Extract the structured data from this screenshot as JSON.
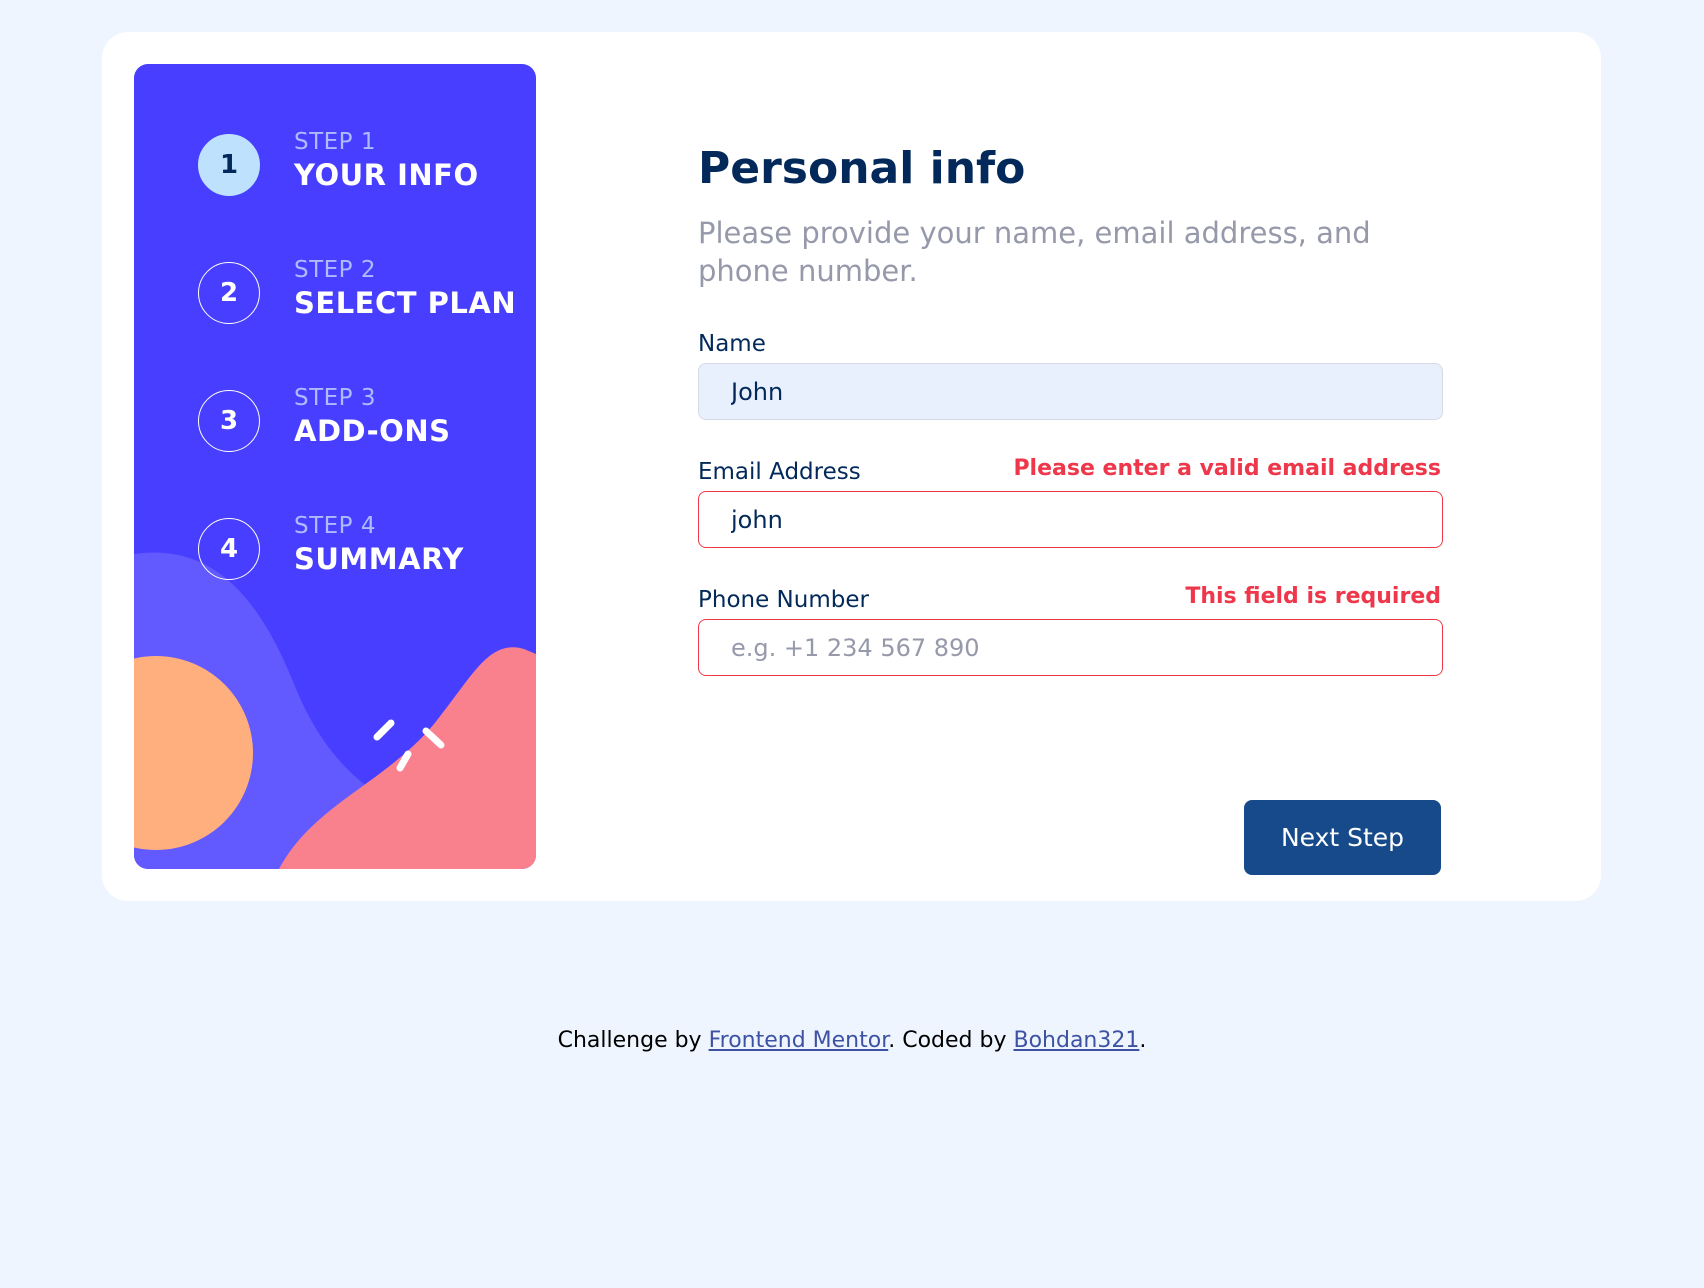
{
  "colors": {
    "page_background": "#eff5ff",
    "sidebar_background": "#483eff",
    "accent_light_blue": "#bee2fd",
    "denim": "#022959",
    "error_red": "#ee374a",
    "button_blue": "#164a8a",
    "grey_text": "#9699aa"
  },
  "sidebar": {
    "steps": [
      {
        "number": "1",
        "label": "STEP 1",
        "title": "YOUR INFO",
        "active": true
      },
      {
        "number": "2",
        "label": "STEP 2",
        "title": "SELECT PLAN",
        "active": false
      },
      {
        "number": "3",
        "label": "STEP 3",
        "title": "ADD-ONS",
        "active": false
      },
      {
        "number": "4",
        "label": "STEP 4",
        "title": "SUMMARY",
        "active": false
      }
    ]
  },
  "form": {
    "title": "Personal info",
    "subtitle": "Please provide your name, email address, and phone number.",
    "fields": {
      "name": {
        "label": "Name",
        "value": "John",
        "placeholder": "",
        "error": ""
      },
      "email": {
        "label": "Email Address",
        "value": "john",
        "placeholder": "",
        "error": "Please enter a valid email address"
      },
      "phone": {
        "label": "Phone Number",
        "value": "",
        "placeholder": "e.g. +1 234 567 890",
        "error": "This field is required"
      }
    },
    "next_label": "Next Step"
  },
  "footer": {
    "prefix": "Challenge by ",
    "link1": "Frontend Mentor",
    "middle": ". Coded by ",
    "link2": "Bohdan321",
    "suffix": "."
  }
}
